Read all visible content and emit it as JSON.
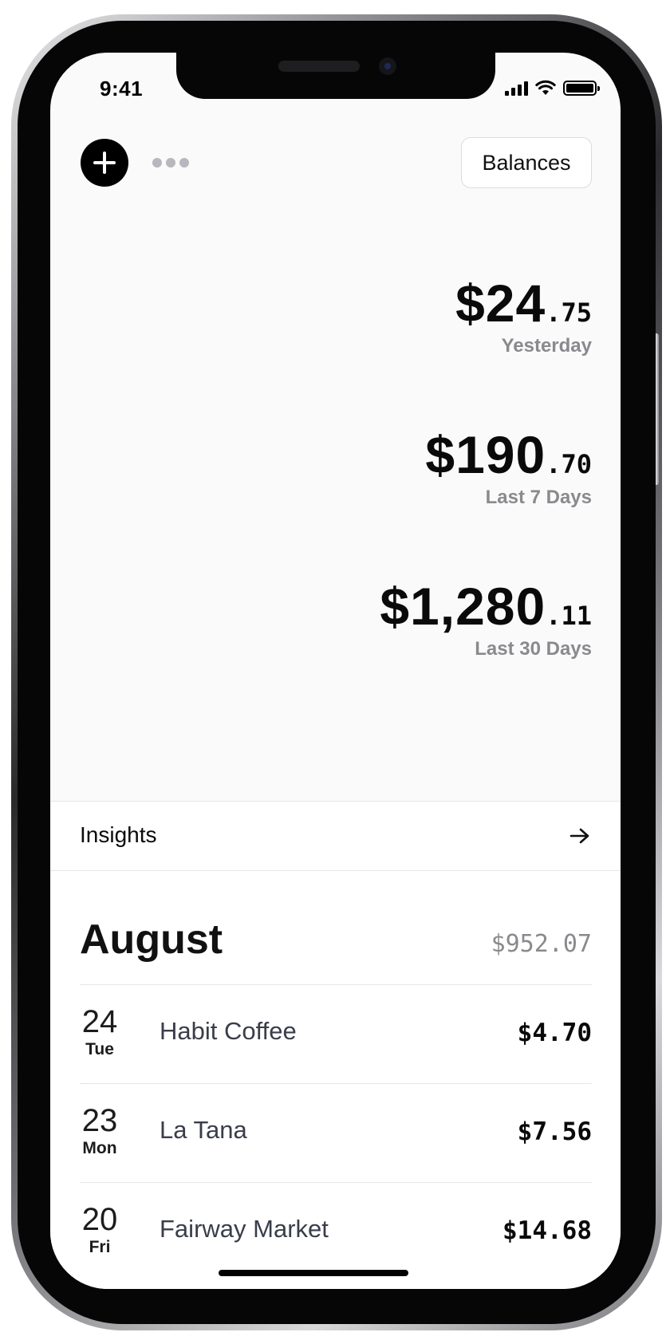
{
  "status_bar": {
    "time": "9:41",
    "icons": [
      "cellular-signal-icon",
      "wifi-icon",
      "battery-icon"
    ]
  },
  "header": {
    "add_icon": "plus-icon",
    "more_icon": "more-dots-icon",
    "balances_label": "Balances"
  },
  "totals": [
    {
      "dollars": "$24",
      "cents": ".75",
      "period": "Yesterday"
    },
    {
      "dollars": "$190",
      "cents": ".70",
      "period": "Last 7 Days"
    },
    {
      "dollars": "$1,280",
      "cents": ".11",
      "period": "Last 30 Days"
    }
  ],
  "insights": {
    "label": "Insights",
    "arrow_icon": "arrow-right-icon"
  },
  "month": {
    "title": "August",
    "total": "$952.07"
  },
  "transactions": [
    {
      "day": "24",
      "weekday": "Tue",
      "merchant": "Habit Coffee",
      "amount": "$4.70"
    },
    {
      "day": "23",
      "weekday": "Mon",
      "merchant": "La Tana",
      "amount": "$7.56"
    },
    {
      "day": "20",
      "weekday": "Fri",
      "merchant": "Fairway Market",
      "amount": "$14.68"
    }
  ],
  "colors": {
    "background": "#fafafa",
    "accent": "#000000",
    "secondary_text": "#8a8a8e",
    "merchant_text": "#3a3d4a"
  }
}
